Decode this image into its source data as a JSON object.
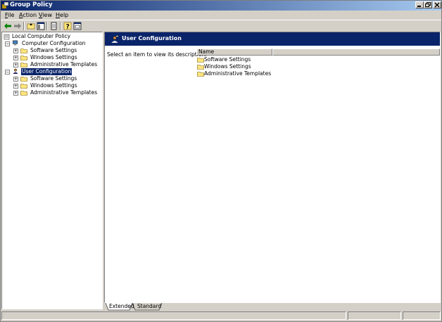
{
  "window": {
    "title": "Group Policy",
    "colors": {
      "title_start": "#0a246a",
      "title_end": "#a6caf0",
      "face": "#d4d0c8",
      "selection": "#0a246a"
    }
  },
  "menu": {
    "items": [
      {
        "label_u": "F",
        "label_rest": "ile"
      },
      {
        "label_u": "A",
        "label_rest": "ction"
      },
      {
        "label_u": "V",
        "label_rest": "iew"
      },
      {
        "label_u": "H",
        "label_rest": "elp"
      }
    ]
  },
  "toolbar": {
    "icons": [
      "back-arrow-icon",
      "forward-arrow-icon",
      "up-folder-icon",
      "show-hide-tree-icon",
      "export-list-icon",
      "help-icon",
      "properties-icon"
    ]
  },
  "tree": {
    "root": "Local Computer Policy",
    "computer_config": {
      "label": "Computer Configuration",
      "children": [
        "Software Settings",
        "Windows Settings",
        "Administrative Templates"
      ]
    },
    "user_config": {
      "label": "User Configuration",
      "children": [
        "Software Settings",
        "Windows Settings",
        "Administrative Templates"
      ]
    }
  },
  "right_pane": {
    "header_title": "User Configuration",
    "description": "Select an item to view its description.",
    "columns": [
      "Name"
    ],
    "items": [
      "Software Settings",
      "Windows Settings",
      "Administrative Templates"
    ]
  },
  "tabs": [
    "Extended",
    "Standard"
  ]
}
